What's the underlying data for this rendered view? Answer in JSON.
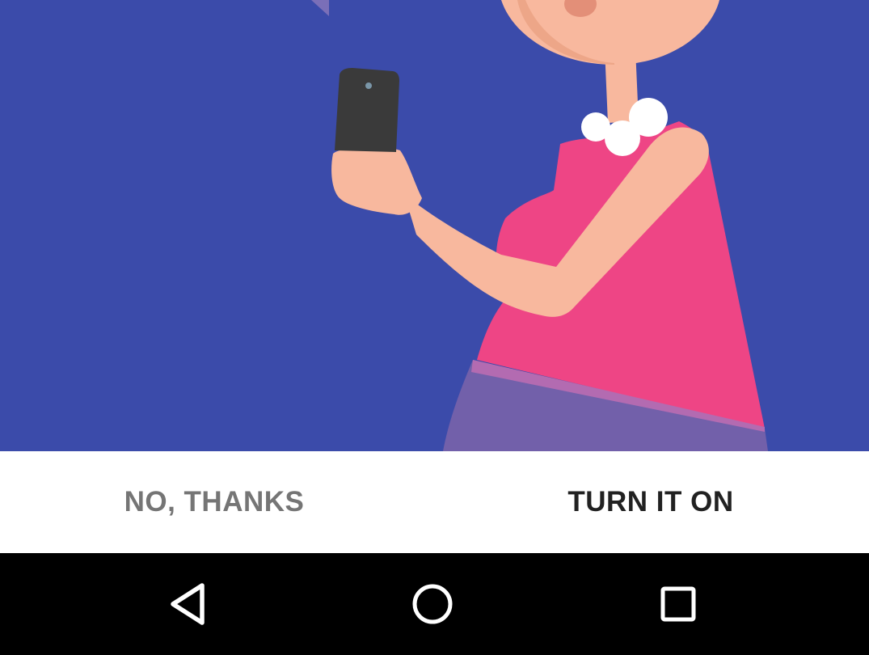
{
  "colors": {
    "background": "#3B4BAA",
    "action_bar": "#FFFFFF",
    "secondary_text": "#757575",
    "primary_text": "#212121",
    "nav_bar": "#000000",
    "nav_icons": "#FFFFFF",
    "dress": "#EE4585",
    "skin": "#F8B89E",
    "skirt": "#7260AA",
    "phone": "#3A3A3A",
    "necklace": "#FFFFFF"
  },
  "illustration": {
    "subject": "woman-holding-phone"
  },
  "actions": {
    "dismiss_label": "NO, THANKS",
    "confirm_label": "TURN IT ON"
  },
  "nav": {
    "back_icon": "back-triangle-icon",
    "home_icon": "home-circle-icon",
    "recents_icon": "recents-square-icon"
  }
}
